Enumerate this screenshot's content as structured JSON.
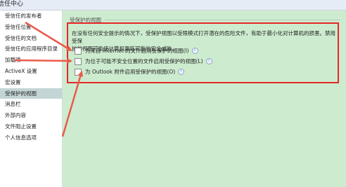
{
  "window": {
    "title": "信任中心"
  },
  "sidebar": {
    "items": [
      {
        "label": "受信任的发布者"
      },
      {
        "label": "受信任位置"
      },
      {
        "label": "受信任的文档"
      },
      {
        "label": "受信任的应用程序目录"
      },
      {
        "label": "加载项"
      },
      {
        "label": "ActiveX 设置"
      },
      {
        "label": "宏设置"
      },
      {
        "label": "受保护的视图"
      },
      {
        "label": "消息栏"
      },
      {
        "label": "外部内容"
      },
      {
        "label": "文件阻止设置"
      },
      {
        "label": "个人信息选项"
      }
    ],
    "selected_index": 7
  },
  "main": {
    "section_heading": "受保护的视图",
    "description_line1": "在没有任何安全提示的情况下，受保护视图以受限模式打开潜在的危险文件，有助于最小化对计算机的损害。禁用受保",
    "description_line2": "护的视图可能使计算机面临可能的安全威胁。",
    "options": [
      {
        "label": "为来自 Internet 的文件启用受保护的视图(I)",
        "checked": false
      },
      {
        "label": "为位于可能不安全位置的文件启用受保护的视图(L)",
        "checked": false
      },
      {
        "label": "为 Outlook 附件启用受保护的视图(O)",
        "checked": false
      }
    ]
  },
  "colors": {
    "highlight_box": "#e8262a",
    "arrow": "#ea5a4a",
    "content_bg": "#cdeccf",
    "selected_nav": "#c4d5d6"
  }
}
